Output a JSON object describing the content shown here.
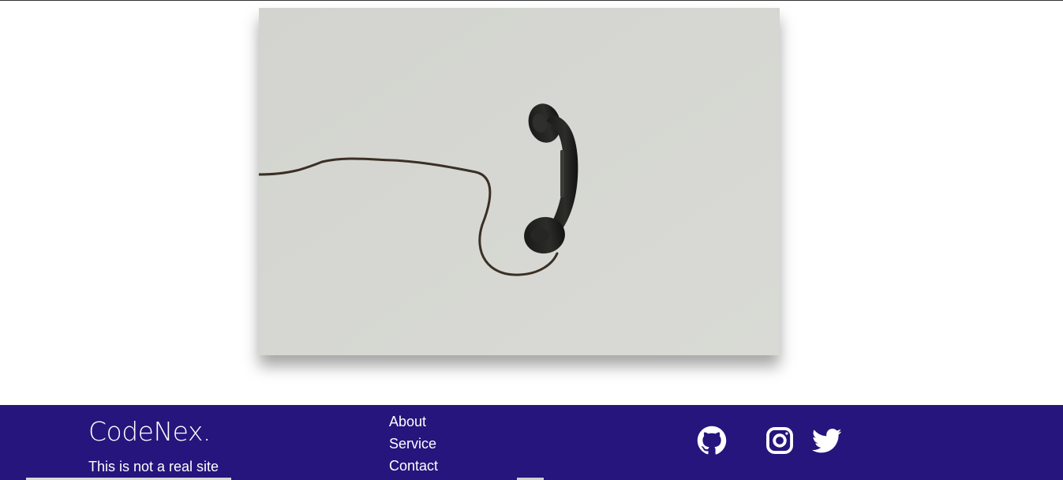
{
  "hero": {
    "image_subject": "black-telephone-handset-on-cord"
  },
  "footer": {
    "brand": "CodeNex.",
    "tagline": "This is not a real site",
    "nav": {
      "about": "About",
      "service": "Service",
      "contact": "Contact"
    },
    "social": [
      "github-icon",
      "instagram-icon",
      "twitter-icon"
    ]
  },
  "colors": {
    "footer_bg": "#25157c",
    "photo_bg": "#d5d5d0",
    "text": "#ffffff"
  }
}
